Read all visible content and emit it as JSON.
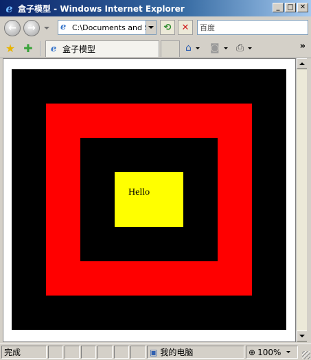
{
  "window": {
    "title": "盒子模型 - Windows Internet Explorer",
    "controls": {
      "minimize": "_",
      "maximize": "□",
      "close": "✕"
    }
  },
  "toolbar": {
    "address": "C:\\Documents and Settings",
    "search_placeholder": "百度",
    "refresh_icon": "refresh-icon",
    "stop_icon": "stop-icon"
  },
  "tabs": {
    "active_label": "盒子模型",
    "chevron": "»"
  },
  "content": {
    "box_text": "Hello",
    "colors": {
      "outer": "#000000",
      "second": "#ff0000",
      "third": "#000000",
      "inner": "#ffff00"
    }
  },
  "status": {
    "text": "完成",
    "zone": "我的电脑",
    "zoom": "100%"
  }
}
